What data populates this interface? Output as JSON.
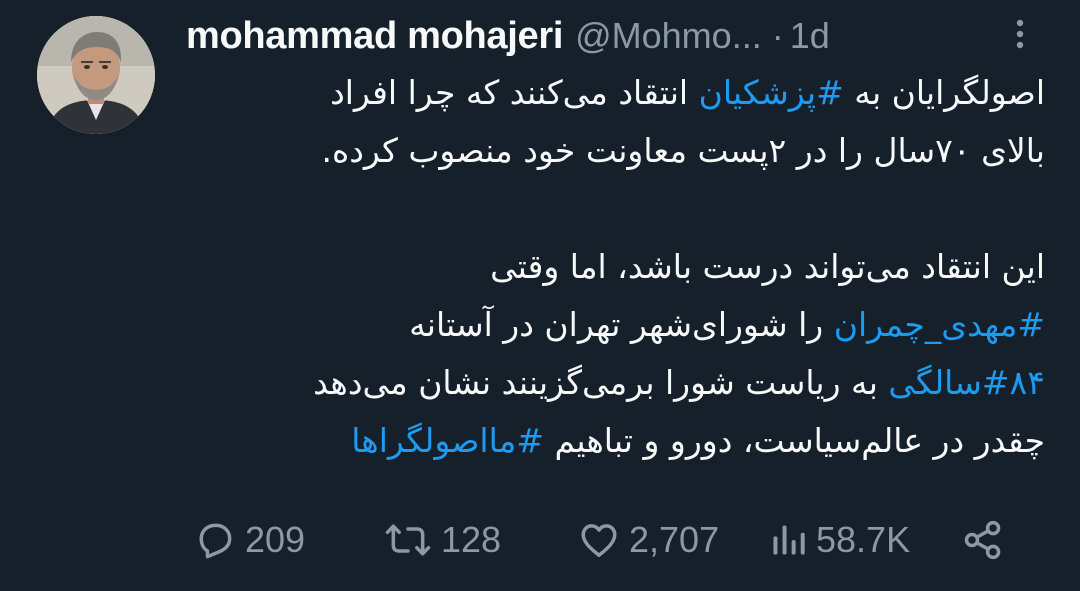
{
  "tweet": {
    "author": {
      "display_name": "mohammad mohajeri",
      "handle": "@Mohmo...",
      "avatar_icon": "profile-photo"
    },
    "separator": "·",
    "timestamp": "1d",
    "body_lines": [
      {
        "type": "text",
        "parts": [
          {
            "text": "اصولگرایان به ",
            "hashtag": false
          },
          {
            "text": "#پزشکیان",
            "hashtag": true
          },
          {
            "text": " انتقاد می‌کنند که چرا افراد",
            "hashtag": false
          }
        ]
      },
      {
        "type": "text",
        "parts": [
          {
            "text": "بالای ۷۰سال را در ۲پست معاونت خود منصوب کرده.",
            "hashtag": false
          }
        ]
      },
      {
        "type": "gap"
      },
      {
        "type": "text",
        "parts": [
          {
            "text": "این انتقاد می‌تواند درست باشد، اما وقتی",
            "hashtag": false
          }
        ]
      },
      {
        "type": "text",
        "parts": [
          {
            "text": "#مهدی_چمران",
            "hashtag": true
          },
          {
            "text": " را شورای‌شهر تهران  در آستانه",
            "hashtag": false
          }
        ]
      },
      {
        "type": "text",
        "parts": [
          {
            "text": "#۸۴سالگی",
            "hashtag": true
          },
          {
            "text": " به ریاست شورا برمی‌گزینند نشان می‌دهد",
            "hashtag": false
          }
        ]
      },
      {
        "type": "text",
        "parts": [
          {
            "text": "چقدر در عالم‌سیاست، دورو و تباهیم ",
            "hashtag": false
          },
          {
            "text": "#مااصولگراها",
            "hashtag": true
          }
        ]
      }
    ],
    "actions": {
      "replies": {
        "icon": "reply-icon",
        "count": "209"
      },
      "retweets": {
        "icon": "retweet-icon",
        "count": "128"
      },
      "likes": {
        "icon": "heart-icon",
        "count": "2,707"
      },
      "views": {
        "icon": "views-icon",
        "count": "58.7K"
      },
      "share": {
        "icon": "share-icon"
      }
    }
  },
  "colors": {
    "background": "#15202b",
    "text": "#f7f9f9",
    "muted": "#8b98a5",
    "hashtag": "#1d9bf0"
  }
}
